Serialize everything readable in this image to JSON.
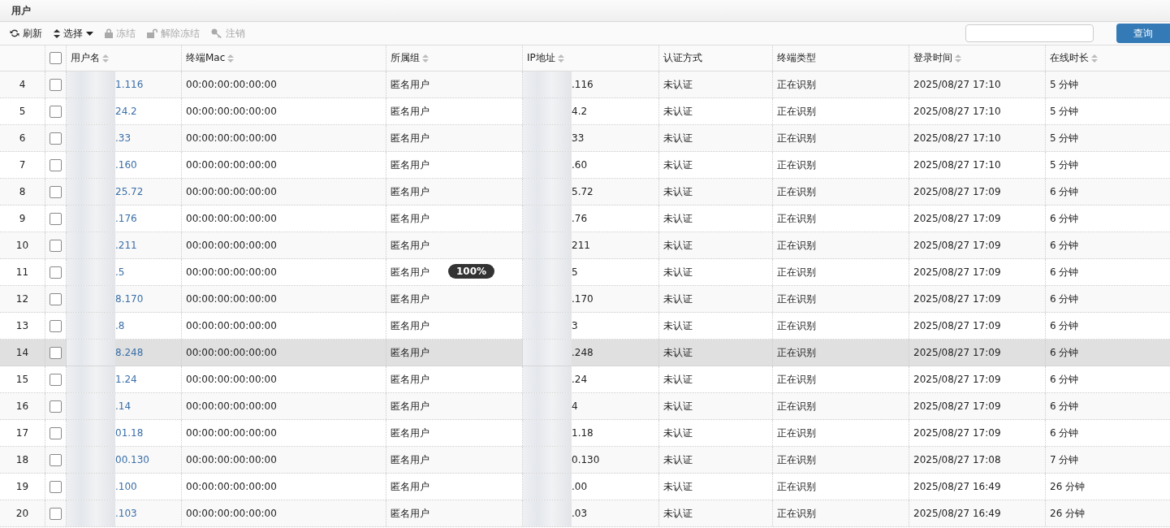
{
  "panel": {
    "title": "用户"
  },
  "toolbar": [
    {
      "label": "刷新",
      "kind": "button",
      "disabled": false
    },
    {
      "label": "选择",
      "kind": "dropdown",
      "disabled": false
    },
    {
      "label": "冻结",
      "kind": "button",
      "disabled": true
    },
    {
      "label": "解除冻结",
      "kind": "button",
      "disabled": true
    },
    {
      "label": "注销",
      "kind": "button",
      "disabled": true
    }
  ],
  "search": {
    "button": "查询"
  },
  "table": {
    "select_all_checked": false,
    "columns": [
      {
        "label": "用户名",
        "sortable": true
      },
      {
        "label": "终端Mac",
        "sortable": true
      },
      {
        "label": "所属组",
        "sortable": true
      },
      {
        "label": "IP地址",
        "sortable": true
      },
      {
        "label": "认证方式",
        "sortable": false
      },
      {
        "label": "终端类型",
        "sortable": false
      },
      {
        "label": "登录时间",
        "sortable": true
      },
      {
        "label": "在线时长",
        "sortable": true
      }
    ],
    "rows": [
      {
        "index": "4",
        "checked": false,
        "selected": false,
        "user": "1.116",
        "mac": "00:00:00:00:00:00",
        "group": "匿名用户",
        "ip": ".116",
        "auth": "未认证",
        "type": "正在识别",
        "login": "2025/08/27 17:10",
        "duration": "5 分钟"
      },
      {
        "index": "5",
        "checked": false,
        "selected": false,
        "user": "24.2",
        "mac": "00:00:00:00:00:00",
        "group": "匿名用户",
        "ip": "4.2",
        "auth": "未认证",
        "type": "正在识别",
        "login": "2025/08/27 17:10",
        "duration": "5 分钟"
      },
      {
        "index": "6",
        "checked": false,
        "selected": false,
        "user": ".33",
        "mac": "00:00:00:00:00:00",
        "group": "匿名用户",
        "ip": "33",
        "auth": "未认证",
        "type": "正在识别",
        "login": "2025/08/27 17:10",
        "duration": "5 分钟"
      },
      {
        "index": "7",
        "checked": false,
        "selected": false,
        "user": ".160",
        "mac": "00:00:00:00:00:00",
        "group": "匿名用户",
        "ip": ".60",
        "auth": "未认证",
        "type": "正在识别",
        "login": "2025/08/27 17:10",
        "duration": "5 分钟"
      },
      {
        "index": "8",
        "checked": false,
        "selected": false,
        "user": "25.72",
        "mac": "00:00:00:00:00:00",
        "group": "匿名用户",
        "ip": "5.72",
        "auth": "未认证",
        "type": "正在识别",
        "login": "2025/08/27 17:09",
        "duration": "6 分钟"
      },
      {
        "index": "9",
        "checked": false,
        "selected": false,
        "user": ".176",
        "mac": "00:00:00:00:00:00",
        "group": "匿名用户",
        "ip": ".76",
        "auth": "未认证",
        "type": "正在识别",
        "login": "2025/08/27 17:09",
        "duration": "6 分钟"
      },
      {
        "index": "10",
        "checked": false,
        "selected": false,
        "user": ".211",
        "mac": "00:00:00:00:00:00",
        "group": "匿名用户",
        "ip": "211",
        "auth": "未认证",
        "type": "正在识别",
        "login": "2025/08/27 17:09",
        "duration": "6 分钟"
      },
      {
        "index": "11",
        "checked": false,
        "selected": false,
        "user": ".5",
        "mac": "00:00:00:00:00:00",
        "group": "匿名用户",
        "ip": "5",
        "auth": "未认证",
        "type": "正在识别",
        "login": "2025/08/27 17:09",
        "duration": "6 分钟"
      },
      {
        "index": "12",
        "checked": false,
        "selected": false,
        "user": "8.170",
        "mac": "00:00:00:00:00:00",
        "group": "匿名用户",
        "ip": ".170",
        "auth": "未认证",
        "type": "正在识别",
        "login": "2025/08/27 17:09",
        "duration": "6 分钟"
      },
      {
        "index": "13",
        "checked": false,
        "selected": false,
        "user": ".8",
        "mac": "00:00:00:00:00:00",
        "group": "匿名用户",
        "ip": "3",
        "auth": "未认证",
        "type": "正在识别",
        "login": "2025/08/27 17:09",
        "duration": "6 分钟"
      },
      {
        "index": "14",
        "checked": false,
        "selected": true,
        "user": "8.248",
        "mac": "00:00:00:00:00:00",
        "group": "匿名用户",
        "ip": ".248",
        "auth": "未认证",
        "type": "正在识别",
        "login": "2025/08/27 17:09",
        "duration": "6 分钟"
      },
      {
        "index": "15",
        "checked": false,
        "selected": false,
        "user": "1.24",
        "mac": "00:00:00:00:00:00",
        "group": "匿名用户",
        "ip": ".24",
        "auth": "未认证",
        "type": "正在识别",
        "login": "2025/08/27 17:09",
        "duration": "6 分钟"
      },
      {
        "index": "16",
        "checked": false,
        "selected": false,
        "user": ".14",
        "mac": "00:00:00:00:00:00",
        "group": "匿名用户",
        "ip": "4",
        "auth": "未认证",
        "type": "正在识别",
        "login": "2025/08/27 17:09",
        "duration": "6 分钟"
      },
      {
        "index": "17",
        "checked": false,
        "selected": false,
        "user": "01.18",
        "mac": "00:00:00:00:00:00",
        "group": "匿名用户",
        "ip": "1.18",
        "auth": "未认证",
        "type": "正在识别",
        "login": "2025/08/27 17:09",
        "duration": "6 分钟"
      },
      {
        "index": "18",
        "checked": false,
        "selected": false,
        "user": "00.130",
        "mac": "00:00:00:00:00:00",
        "group": "匿名用户",
        "ip": "0.130",
        "auth": "未认证",
        "type": "正在识别",
        "login": "2025/08/27 17:08",
        "duration": "7 分钟"
      },
      {
        "index": "19",
        "checked": false,
        "selected": false,
        "user": ".100",
        "mac": "00:00:00:00:00:00",
        "group": "匿名用户",
        "ip": ".00",
        "auth": "未认证",
        "type": "正在识别",
        "login": "2025/08/27 16:49",
        "duration": "26 分钟"
      },
      {
        "index": "20",
        "checked": false,
        "selected": false,
        "user": ".103",
        "mac": "00:00:00:00:00:00",
        "group": "匿名用户",
        "ip": ".03",
        "auth": "未认证",
        "type": "正在识别",
        "login": "2025/08/27 16:49",
        "duration": "26 分钟"
      }
    ]
  },
  "zoom_badge": "100%"
}
